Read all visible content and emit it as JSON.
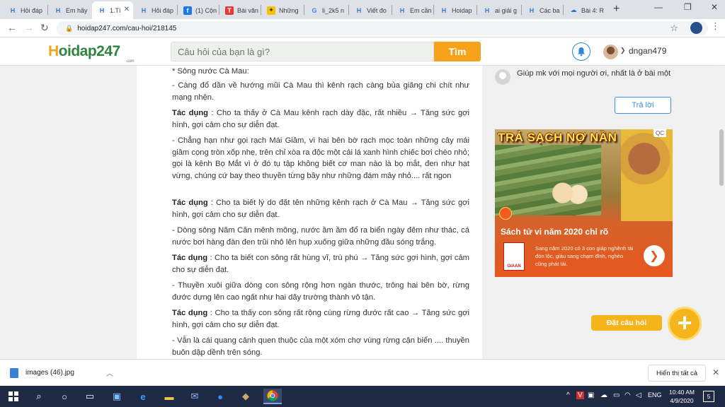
{
  "browser": {
    "tabs": [
      {
        "label": "Hỏi đáp",
        "icon": "h"
      },
      {
        "label": "Em hãy",
        "icon": "h"
      },
      {
        "label": "1.Tì",
        "icon": "h",
        "active": true
      },
      {
        "label": "Hỏi đáp",
        "icon": "h"
      },
      {
        "label": "(1) Cộn",
        "icon": "fb"
      },
      {
        "label": "Bài văn",
        "icon": "t"
      },
      {
        "label": "Những",
        "icon": "y"
      },
      {
        "label": "li_2k5 n",
        "icon": "g"
      },
      {
        "label": "Viết đo",
        "icon": "h"
      },
      {
        "label": "Em cần",
        "icon": "h"
      },
      {
        "label": "Hoidap",
        "icon": "h"
      },
      {
        "label": "ai giải g",
        "icon": "h"
      },
      {
        "label": "Các ba",
        "icon": "h"
      },
      {
        "label": "Bài 4: R",
        "icon": "cloud"
      }
    ],
    "url": "hoidap247.com/cau-hoi/218145"
  },
  "site": {
    "logo_part1": "H",
    "logo_part2": "oidap247",
    "logo_domain": ".com",
    "search_placeholder": "Câu hỏi của bạn là gì?",
    "search_button": "Tìm",
    "username": "dngan479"
  },
  "article": {
    "paragraphs": [
      {
        "text": "* Sông nước Cà Mau:"
      },
      {
        "text": "- Càng đổ dần về hướng mũi Cà Mau thì kênh rạch càng bủa giăng chi chít như mạng nhện."
      },
      {
        "bold": "Tác dụng",
        "text": " : Cho ta thấy ở Cà Mau kênh rạch dày đặc, rất nhiều → Tăng sức gợi hình, gợi cảm cho sự diễn đạt."
      },
      {
        "text": "- Chẳng hạn như gọi rạch Mái Giầm, vì hai bên bờ rạch mọc toàn những cây mái giầm cọng tròn xốp nhẹ, trên chỉ xòa ra độc một cái lá xanh hình chiếc bơi chèo nhỏ; gọi là kênh Bọ Mắt vì ở đó tụ tập không biết cơ man nào là bọ mắt, đen như hạt vừng, chúng cứ bay theo thuyền từng bầy như những đám mây nhỏ.... rất ngon"
      },
      {
        "bold": "Tác dụng",
        "text": " : Cho ta biết lý do đặt tên những kênh rạch ở Cà Mau → Tăng sức gợi hình, gợi cảm cho sự diễn đạt."
      },
      {
        "text": "- Dòng sông Năm Căn mênh mông, nước ầm ầm đổ ra biển ngày đêm như thác, cá nước bơi hàng đàn đen trũi nhô lên hụp xuống giữa những đầu sóng trắng."
      },
      {
        "bold": "Tác dụng",
        "text": " : Cho ta biết con sông rất hùng vĩ, trù phú → Tăng sức gợi hình, gợi cảm cho sự diễn đạt."
      },
      {
        "text": "- Thuyền xuôi giữa dòng con sông rộng hơn ngàn thước, trông hai bên bờ, rừng đước dựng lên cao ngất như hai dãy trường thành vô tận."
      },
      {
        "bold": "Tác dụng",
        "text": " : Cho ta thấy con sông rất rộng cùng rừng đước rất cao  → Tăng sức gợi hình, gợi cảm cho sự diễn đạt."
      },
      {
        "text": "- Vẫn là cái quang cảnh quen thuộc của một xóm chợ vùng rừng cận biển .... thuyền buôn dập dềnh trên sóng."
      }
    ]
  },
  "sidebar": {
    "comment_text": "Giúp mk với mọi người ơi, nhất là ở bài một",
    "reply_button": "Trả lời",
    "ad": {
      "headline": "TRẢ SẠCH NỢ NẦN",
      "qc_label": "QC",
      "subtitle": "Sách tử vi năm 2020 chỉ rõ",
      "description": "Sang năm 2020 có 3 con giáp nghênh tài đón lộc, giàu sang chạm đỉnh, nghèo cũng phát tài.",
      "logo_text": "GIAAN"
    },
    "ask_label": "Đặt câu hỏi",
    "ask_button": "+"
  },
  "downloads": {
    "file_name": "images (46).jpg",
    "show_all": "Hiển thị tất cả"
  },
  "taskbar": {
    "language": "ENG",
    "time": "10:40 AM",
    "date": "4/9/2020",
    "notifications": "5"
  }
}
